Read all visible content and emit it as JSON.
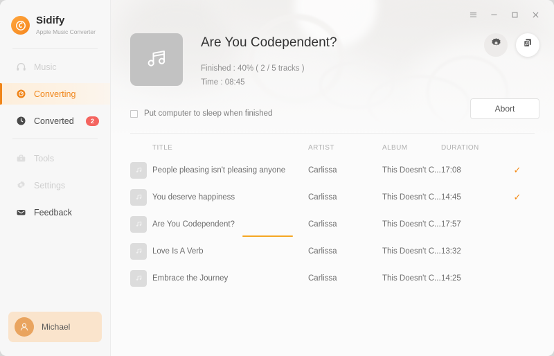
{
  "app": {
    "brand_name": "Sidify",
    "brand_subtitle": "Apple Music Converter"
  },
  "window_controls": {
    "menu_label": "≡",
    "minimize_label": "—",
    "maximize_label": "□",
    "close_label": "✕"
  },
  "sidebar": {
    "items": [
      {
        "id": "music",
        "label": "Music",
        "icon": "headphones-icon",
        "state": "disabled",
        "badge": null
      },
      {
        "id": "converting",
        "label": "Converting",
        "icon": "converting-icon",
        "state": "active",
        "badge": null
      },
      {
        "id": "converted",
        "label": "Converted",
        "icon": "clock-icon",
        "state": "normal",
        "badge": "2"
      },
      {
        "id": "tools",
        "label": "Tools",
        "icon": "toolbox-icon",
        "state": "disabled",
        "badge": null
      },
      {
        "id": "settings",
        "label": "Settings",
        "icon": "gear-icon",
        "state": "disabled",
        "badge": null
      },
      {
        "id": "feedback",
        "label": "Feedback",
        "icon": "envelope-icon",
        "state": "normal",
        "badge": null
      }
    ],
    "user": {
      "name": "Michael",
      "avatar_icon": "person-icon"
    }
  },
  "hero": {
    "cover_icon": "music-note-icon",
    "title": "Are You Codependent?",
    "finished_line": "Finished : 40% ( 2 / 5 tracks )",
    "time_line": "Time :  08:45",
    "sleep_checkbox_label": "Put computer to sleep when finished",
    "sleep_checkbox_checked": false,
    "abort_label": "Abort",
    "settings_button_icon": "gear-icon",
    "output_folder_button_icon": "music-file-icon"
  },
  "table": {
    "headers": {
      "title": "TITLE",
      "artist": "ARTIST",
      "album": "ALBUM",
      "duration": "DURATION"
    },
    "rows": [
      {
        "title": "People pleasing isn't pleasing anyone",
        "artist": "Carlissa",
        "album": "This Doesn't C...",
        "duration": "17:08",
        "status": "done",
        "status_icon": "check-icon",
        "progress_percent": 100
      },
      {
        "title": "You deserve happiness",
        "artist": "Carlissa",
        "album": "This Doesn't C...",
        "duration": "14:45",
        "status": "done",
        "status_icon": "check-icon",
        "progress_percent": 100
      },
      {
        "title": "Are You Codependent?",
        "artist": "Carlissa",
        "album": "This Doesn't C...",
        "duration": "17:57",
        "status": "converting",
        "status_icon": "",
        "progress_percent": 17
      },
      {
        "title": "Love Is A Verb",
        "artist": "Carlissa",
        "album": "This Doesn't C...",
        "duration": "13:32",
        "status": "pending",
        "status_icon": "",
        "progress_percent": 0
      },
      {
        "title": "Embrace the Journey",
        "artist": "Carlissa",
        "album": "This Doesn't C...",
        "duration": "14:25",
        "status": "pending",
        "status_icon": "",
        "progress_percent": 0
      }
    ]
  },
  "colors": {
    "accent": "#f08519",
    "progress": "#f5a623",
    "badge": "#f4645f",
    "sidebar_bg": "#f7f7f7",
    "user_chip_bg": "#fae4cc"
  }
}
